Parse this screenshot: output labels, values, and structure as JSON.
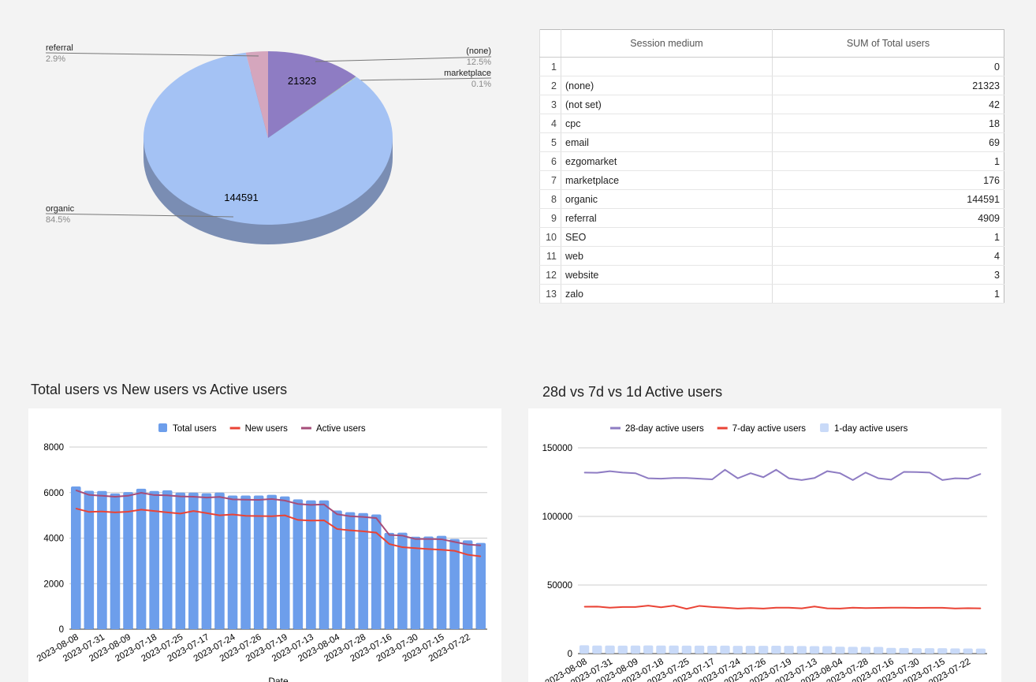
{
  "pie": {
    "slices": [
      {
        "label": "(none)",
        "percent": "12.5%",
        "value": 21323,
        "color": "#8e7cc3"
      },
      {
        "label": "marketplace",
        "percent": "0.1%",
        "value": 176,
        "color": "#b6d7a8"
      },
      {
        "label": "organic",
        "percent": "84.5%",
        "value": 144591,
        "color": "#a4c2f4"
      },
      {
        "label": "referral",
        "percent": "2.9%",
        "value": 4909,
        "color": "#d5a6bd"
      }
    ],
    "shown_values": [
      "21323",
      "144591"
    ],
    "side_color": "#7a8db3"
  },
  "table": {
    "headers": [
      "",
      "Session medium",
      "SUM of Total users"
    ],
    "rows": [
      [
        "1",
        "",
        "0"
      ],
      [
        "2",
        "(none)",
        "21323"
      ],
      [
        "3",
        "(not set)",
        "42"
      ],
      [
        "4",
        "cpc",
        "18"
      ],
      [
        "5",
        "email",
        "69"
      ],
      [
        "6",
        "ezgomarket",
        "1"
      ],
      [
        "7",
        "marketplace",
        "176"
      ],
      [
        "8",
        "organic",
        "144591"
      ],
      [
        "9",
        "referral",
        "4909"
      ],
      [
        "10",
        "SEO",
        "1"
      ],
      [
        "11",
        "web",
        "4"
      ],
      [
        "12",
        "website",
        "3"
      ],
      [
        "13",
        "zalo",
        "1"
      ]
    ]
  },
  "chart_data": [
    {
      "type": "bar",
      "title": "Total users vs New users vs Active users",
      "xlabel": "Date",
      "ylim": [
        0,
        8000
      ],
      "yticks": [
        0,
        2000,
        4000,
        6000,
        8000
      ],
      "legend": "top",
      "grid": true,
      "x": [
        "2023-08-08",
        "",
        "2023-07-31",
        "",
        "2023-08-09",
        "",
        "2023-07-18",
        "",
        "2023-07-25",
        "",
        "2023-07-17",
        "",
        "2023-07-24",
        "",
        "2023-07-26",
        "",
        "2023-07-19",
        "",
        "2023-07-13",
        "",
        "2023-08-04",
        "",
        "2023-07-28",
        "",
        "2023-07-16",
        "",
        "2023-07-30",
        "",
        "2023-07-15",
        "",
        "2023-07-22",
        ""
      ],
      "series": [
        {
          "name": "Total users",
          "type": "bar",
          "color": "#6d9eeb",
          "values": [
            6270,
            6080,
            6070,
            5960,
            6020,
            6170,
            6070,
            6100,
            6000,
            6000,
            5970,
            6000,
            5870,
            5870,
            5870,
            5900,
            5830,
            5700,
            5660,
            5660,
            5210,
            5140,
            5100,
            5040,
            4230,
            4240,
            4060,
            4070,
            4100,
            3960,
            3900,
            3790
          ]
        },
        {
          "name": "New users",
          "type": "line",
          "color": "#ea4335",
          "values": [
            5300,
            5150,
            5170,
            5130,
            5160,
            5250,
            5190,
            5130,
            5080,
            5190,
            5100,
            5000,
            5040,
            4980,
            4970,
            4960,
            5000,
            4800,
            4770,
            4780,
            4400,
            4340,
            4300,
            4240,
            3740,
            3600,
            3560,
            3520,
            3490,
            3440,
            3270,
            3200
          ]
        },
        {
          "name": "Active users",
          "type": "line",
          "color": "#a64d79",
          "values": [
            6100,
            5900,
            5860,
            5820,
            5860,
            5990,
            5890,
            5880,
            5830,
            5820,
            5780,
            5810,
            5700,
            5690,
            5680,
            5720,
            5650,
            5500,
            5460,
            5480,
            5050,
            4960,
            4930,
            4880,
            4140,
            4110,
            3960,
            3960,
            3950,
            3830,
            3720,
            3680
          ]
        }
      ]
    },
    {
      "type": "line",
      "title": "28d vs 7d vs 1d Active users",
      "ylim": [
        0,
        150000
      ],
      "yticks": [
        0,
        50000,
        100000,
        150000
      ],
      "legend": "top",
      "grid": true,
      "x": [
        "2023-08-08",
        "",
        "2023-07-31",
        "",
        "2023-08-09",
        "",
        "2023-07-18",
        "",
        "2023-07-25",
        "",
        "2023-07-17",
        "",
        "2023-07-24",
        "",
        "2023-07-26",
        "",
        "2023-07-19",
        "",
        "2023-07-13",
        "",
        "2023-08-04",
        "",
        "2023-07-28",
        "",
        "2023-07-16",
        "",
        "2023-07-30",
        "",
        "2023-07-15",
        "",
        "2023-07-22",
        ""
      ],
      "series": [
        {
          "name": "28-day active users",
          "type": "line",
          "color": "#8e7cc3",
          "values": [
            132000,
            131800,
            133000,
            132000,
            131500,
            127800,
            127500,
            128000,
            128000,
            127500,
            127000,
            134000,
            127800,
            131500,
            128600,
            134000,
            127800,
            126500,
            128000,
            133000,
            131500,
            126500,
            132000,
            127800,
            126800,
            132500,
            132300,
            132000,
            126500,
            127800,
            127500,
            131000
          ]
        },
        {
          "name": "7-day active users",
          "type": "line",
          "color": "#ea4335",
          "values": [
            34200,
            34300,
            33500,
            34000,
            34000,
            35000,
            33800,
            35000,
            32600,
            34800,
            34000,
            33500,
            32800,
            33200,
            32800,
            33500,
            33500,
            33000,
            34300,
            33000,
            32800,
            33500,
            33200,
            33300,
            33500,
            33500,
            33300,
            33400,
            33400,
            32900,
            33100,
            33000
          ]
        },
        {
          "name": "1-day active users",
          "type": "bar",
          "color": "#c9daf8",
          "values": [
            6100,
            5900,
            5860,
            5820,
            5860,
            5990,
            5890,
            5880,
            5830,
            5820,
            5780,
            5810,
            5700,
            5690,
            5680,
            5720,
            5650,
            5500,
            5460,
            5480,
            5050,
            4960,
            4930,
            4880,
            4140,
            4110,
            3960,
            3960,
            3950,
            3830,
            3720,
            3680
          ]
        }
      ]
    }
  ]
}
